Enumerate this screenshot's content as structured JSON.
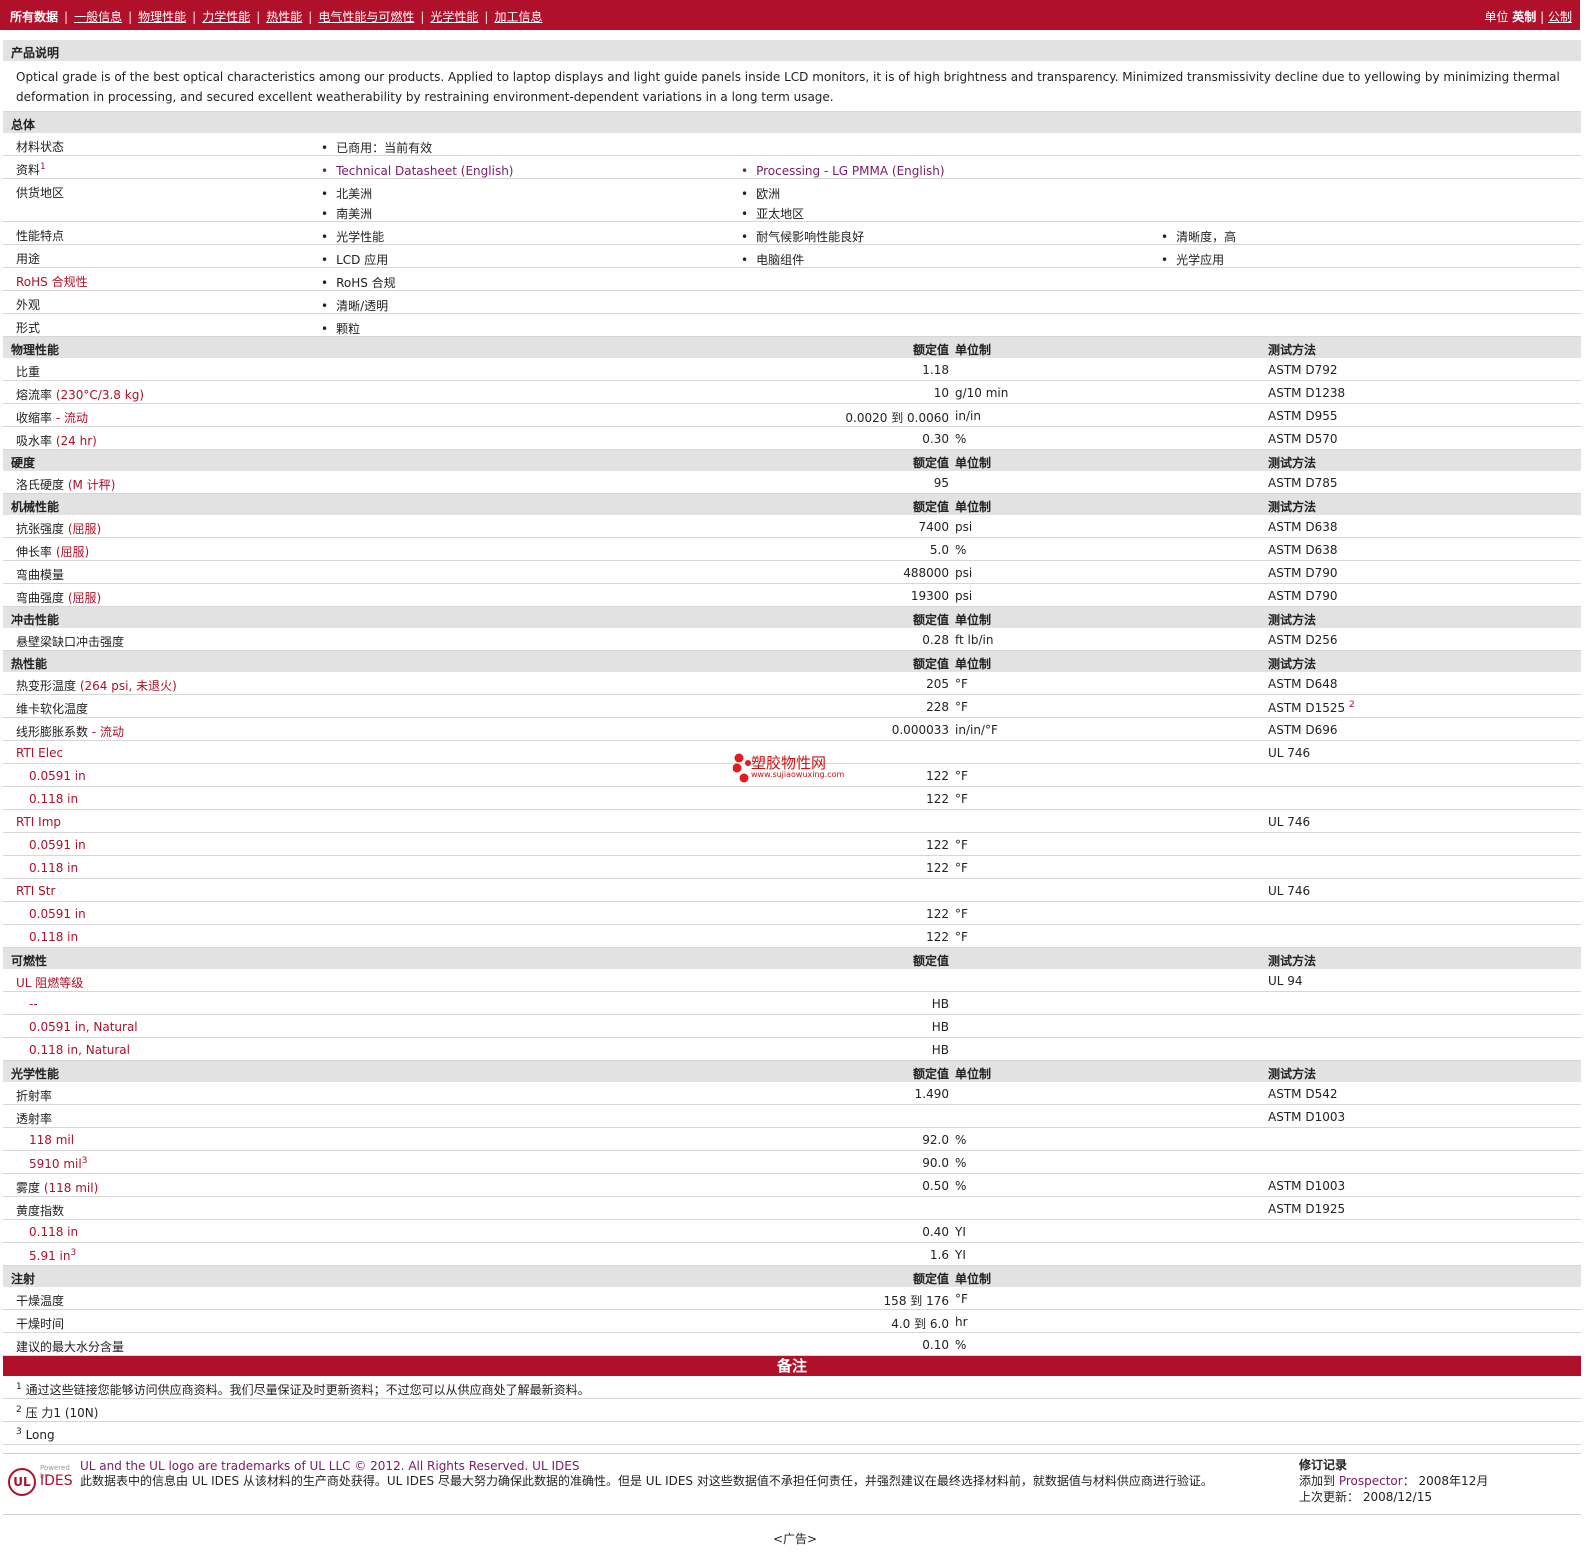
{
  "nav": {
    "all": "所有数据",
    "items": [
      "一般信息",
      "物理性能",
      "力学性能",
      "热性能",
      "电气性能与可燃性",
      "光学性能",
      "加工信息"
    ],
    "units_label": "单位",
    "english": "英制",
    "metric": "公制"
  },
  "product": {
    "title": "产品说明",
    "text": "Optical grade is of the best optical characteristics among our products. Applied to laptop displays and light guide panels inside LCD monitors, it is of high brightness and transparency. Minimized transmissivity decline due to yellowing by minimizing thermal deformation in processing, and secured excellent weatherability by restraining environment-dependent variations in a long term usage."
  },
  "general": {
    "title": "总体",
    "rows": [
      {
        "label": "材料状态",
        "cols": [
          [
            "已商用：当前有效"
          ]
        ]
      },
      {
        "label": "资料",
        "sup": "1",
        "cols": [
          [
            "Technical Datasheet (English)"
          ],
          [
            "Processing - LG PMMA (English)"
          ]
        ]
      },
      {
        "label": "供货地区",
        "cols": [
          [
            "北美洲",
            "南美洲"
          ],
          [
            "欧洲",
            "亚太地区"
          ]
        ]
      },
      {
        "label": "性能特点",
        "cols": [
          [
            "光学性能"
          ],
          [
            "耐气候影响性能良好"
          ],
          [
            "清晰度，高"
          ]
        ]
      },
      {
        "label": "用途",
        "cols": [
          [
            "LCD 应用"
          ],
          [
            "电脑组件"
          ],
          [
            "光学应用"
          ]
        ]
      },
      {
        "label": "RoHS 合规性",
        "cols": [
          [
            "RoHS 合规"
          ]
        ]
      },
      {
        "label": "外观",
        "cols": [
          [
            "清晰/透明"
          ]
        ]
      },
      {
        "label": "形式",
        "cols": [
          [
            "颗粒"
          ]
        ]
      }
    ]
  },
  "sections": [
    {
      "title": "物理性能",
      "hv": "额定值",
      "hu": "单位制",
      "ht": "测试方法",
      "rows": [
        {
          "p": "比重",
          "v": "1.18",
          "u": "",
          "t": "ASTM D792"
        },
        {
          "p": "熔流率",
          "cond": "(230°C/3.8 kg)",
          "v": "10",
          "u": "g/10 min",
          "t": "ASTM D1238"
        },
        {
          "p": "收缩率",
          "cond": "- 流动",
          "v": "0.0020 到  0.0060",
          "u": "in/in",
          "t": "ASTM D955"
        },
        {
          "p": "吸水率",
          "cond": "(24 hr)",
          "v": "0.30",
          "u": "%",
          "t": "ASTM D570"
        }
      ]
    },
    {
      "title": "硬度",
      "hv": "额定值",
      "hu": "单位制",
      "ht": "测试方法",
      "rows": [
        {
          "p": "洛氏硬度",
          "cond": "(M 计秤)",
          "v": "95",
          "u": "",
          "t": "ASTM D785"
        }
      ]
    },
    {
      "title": "机械性能",
      "hv": "额定值",
      "hu": "单位制",
      "ht": "测试方法",
      "rows": [
        {
          "p": "抗张强度",
          "cond": "(屈服)",
          "v": "7400",
          "u": "psi",
          "t": "ASTM D638"
        },
        {
          "p": "伸长率",
          "cond": "(屈服)",
          "v": "5.0",
          "u": "%",
          "t": "ASTM D638"
        },
        {
          "p": "弯曲模量",
          "v": "488000",
          "u": "psi",
          "t": "ASTM D790"
        },
        {
          "p": "弯曲强度",
          "cond": "(屈服)",
          "v": "19300",
          "u": "psi",
          "t": "ASTM D790"
        }
      ]
    },
    {
      "title": "冲击性能",
      "hv": "额定值",
      "hu": "单位制",
      "ht": "测试方法",
      "rows": [
        {
          "p": "悬壁梁缺口冲击强度",
          "v": "0.28",
          "u": "ft lb/in",
          "t": "ASTM D256"
        }
      ]
    },
    {
      "title": "热性能",
      "hv": "额定值",
      "hu": "单位制",
      "ht": "测试方法",
      "rows": [
        {
          "p": "热变形温度",
          "cond": "(264 psi, 未退火)",
          "v": "205",
          "u": "°F",
          "t": "ASTM D648"
        },
        {
          "p": "维卡软化温度",
          "v": "228",
          "u": "°F",
          "t": "ASTM D1525",
          "tsup": "2"
        },
        {
          "p": "线形膨胀系数",
          "cond": "- 流动",
          "v": "0.000033",
          "u": "in/in/°F",
          "t": "ASTM D696"
        },
        {
          "p": "RTI Elec",
          "red": true,
          "v": "",
          "u": "",
          "t": "UL 746"
        },
        {
          "p": "0.0591 in",
          "sub": true,
          "v": "122",
          "u": "°F",
          "t": ""
        },
        {
          "p": "0.118 in",
          "sub": true,
          "v": "122",
          "u": "°F",
          "t": ""
        },
        {
          "p": "RTI Imp",
          "red": true,
          "v": "",
          "u": "",
          "t": "UL 746"
        },
        {
          "p": "0.0591 in",
          "sub": true,
          "v": "122",
          "u": "°F",
          "t": ""
        },
        {
          "p": "0.118 in",
          "sub": true,
          "v": "122",
          "u": "°F",
          "t": ""
        },
        {
          "p": "RTI Str",
          "red": true,
          "v": "",
          "u": "",
          "t": "UL 746"
        },
        {
          "p": "0.0591 in",
          "sub": true,
          "v": "122",
          "u": "°F",
          "t": ""
        },
        {
          "p": "0.118 in",
          "sub": true,
          "v": "122",
          "u": "°F",
          "t": ""
        }
      ]
    },
    {
      "title": "可燃性",
      "hv": "额定值",
      "hu": "",
      "ht": "测试方法",
      "rows": [
        {
          "p": "UL 阻燃等级",
          "red": true,
          "v": "",
          "u": "",
          "t": "UL 94"
        },
        {
          "p": "--",
          "sub": true,
          "v": "HB",
          "u": "",
          "t": ""
        },
        {
          "p": "0.0591 in, Natural",
          "sub": true,
          "v": "HB",
          "u": "",
          "t": ""
        },
        {
          "p": "0.118 in, Natural",
          "sub": true,
          "v": "HB",
          "u": "",
          "t": ""
        }
      ]
    },
    {
      "title": "光学性能",
      "hv": "额定值",
      "hu": "单位制",
      "ht": "测试方法",
      "rows": [
        {
          "p": "折射率",
          "v": "1.490",
          "u": "",
          "t": "ASTM D542"
        },
        {
          "p": "透射率",
          "v": "",
          "u": "",
          "t": "ASTM D1003"
        },
        {
          "p": "118 mil",
          "sub": true,
          "v": "92.0",
          "u": "%",
          "t": ""
        },
        {
          "p": "5910 mil",
          "psup": "3",
          "sub": true,
          "v": "90.0",
          "u": "%",
          "t": ""
        },
        {
          "p": "雾度",
          "cond": "(118 mil)",
          "v": "0.50",
          "u": "%",
          "t": "ASTM D1003"
        },
        {
          "p": "黄度指数",
          "v": "",
          "u": "",
          "t": "ASTM D1925"
        },
        {
          "p": "0.118 in",
          "sub": true,
          "v": "0.40",
          "u": "YI",
          "t": ""
        },
        {
          "p": "5.91 in",
          "psup": "3",
          "sub": true,
          "v": "1.6",
          "u": "YI",
          "t": ""
        }
      ]
    },
    {
      "title": "注射",
      "hv": "额定值",
      "hu": "单位制",
      "ht": "",
      "rows": [
        {
          "p": "干燥温度",
          "v": "158 到  176",
          "u": "°F",
          "t": ""
        },
        {
          "p": "干燥时间",
          "v": "4.0 到  6.0",
          "u": "hr",
          "t": ""
        },
        {
          "p": "建议的最大水分含量",
          "v": "0.10",
          "u": "%",
          "t": ""
        }
      ]
    }
  ],
  "notes": {
    "title": "备注",
    "items": [
      {
        "n": "1",
        "text": "通过这些链接您能够访问供应商资料。我们尽量保证及时更新资料；不过您可以从供应商处了解最新资料。"
      },
      {
        "n": "2",
        "text": "压 力1 (10N)"
      },
      {
        "n": "3",
        "text": "Long"
      }
    ]
  },
  "footer": {
    "logo_powered": "Powered by",
    "logo_ul": "UL",
    "logo_ides": "IDES",
    "trademark": "UL and the UL logo are trademarks of UL LLC © 2012. All Rights Reserved. UL IDES",
    "disclaimer": "此数据表中的信息由  UL IDES 从该材料的生产商处获得。UL IDES 尽最大努力确保此数据的准确性。但是  UL IDES 对这些数据值不承担任何责任，并强烈建议在最终选择材料前，就数据值与材料供应商进行验证。",
    "rev_title": "修订记录",
    "added_label": "添加到 ",
    "prospector": "Prospector",
    "added_value": "：   2008年12月",
    "updated_label": "上次更新：",
    "updated_value": "  2008/12/15"
  },
  "watermark": {
    "cn": "塑胶物性网",
    "url": "www.sujiaowuxing.com"
  },
  "ad": "<广告>",
  "colors": {
    "brand": "#b0102a",
    "section": "#e2e2e2"
  }
}
